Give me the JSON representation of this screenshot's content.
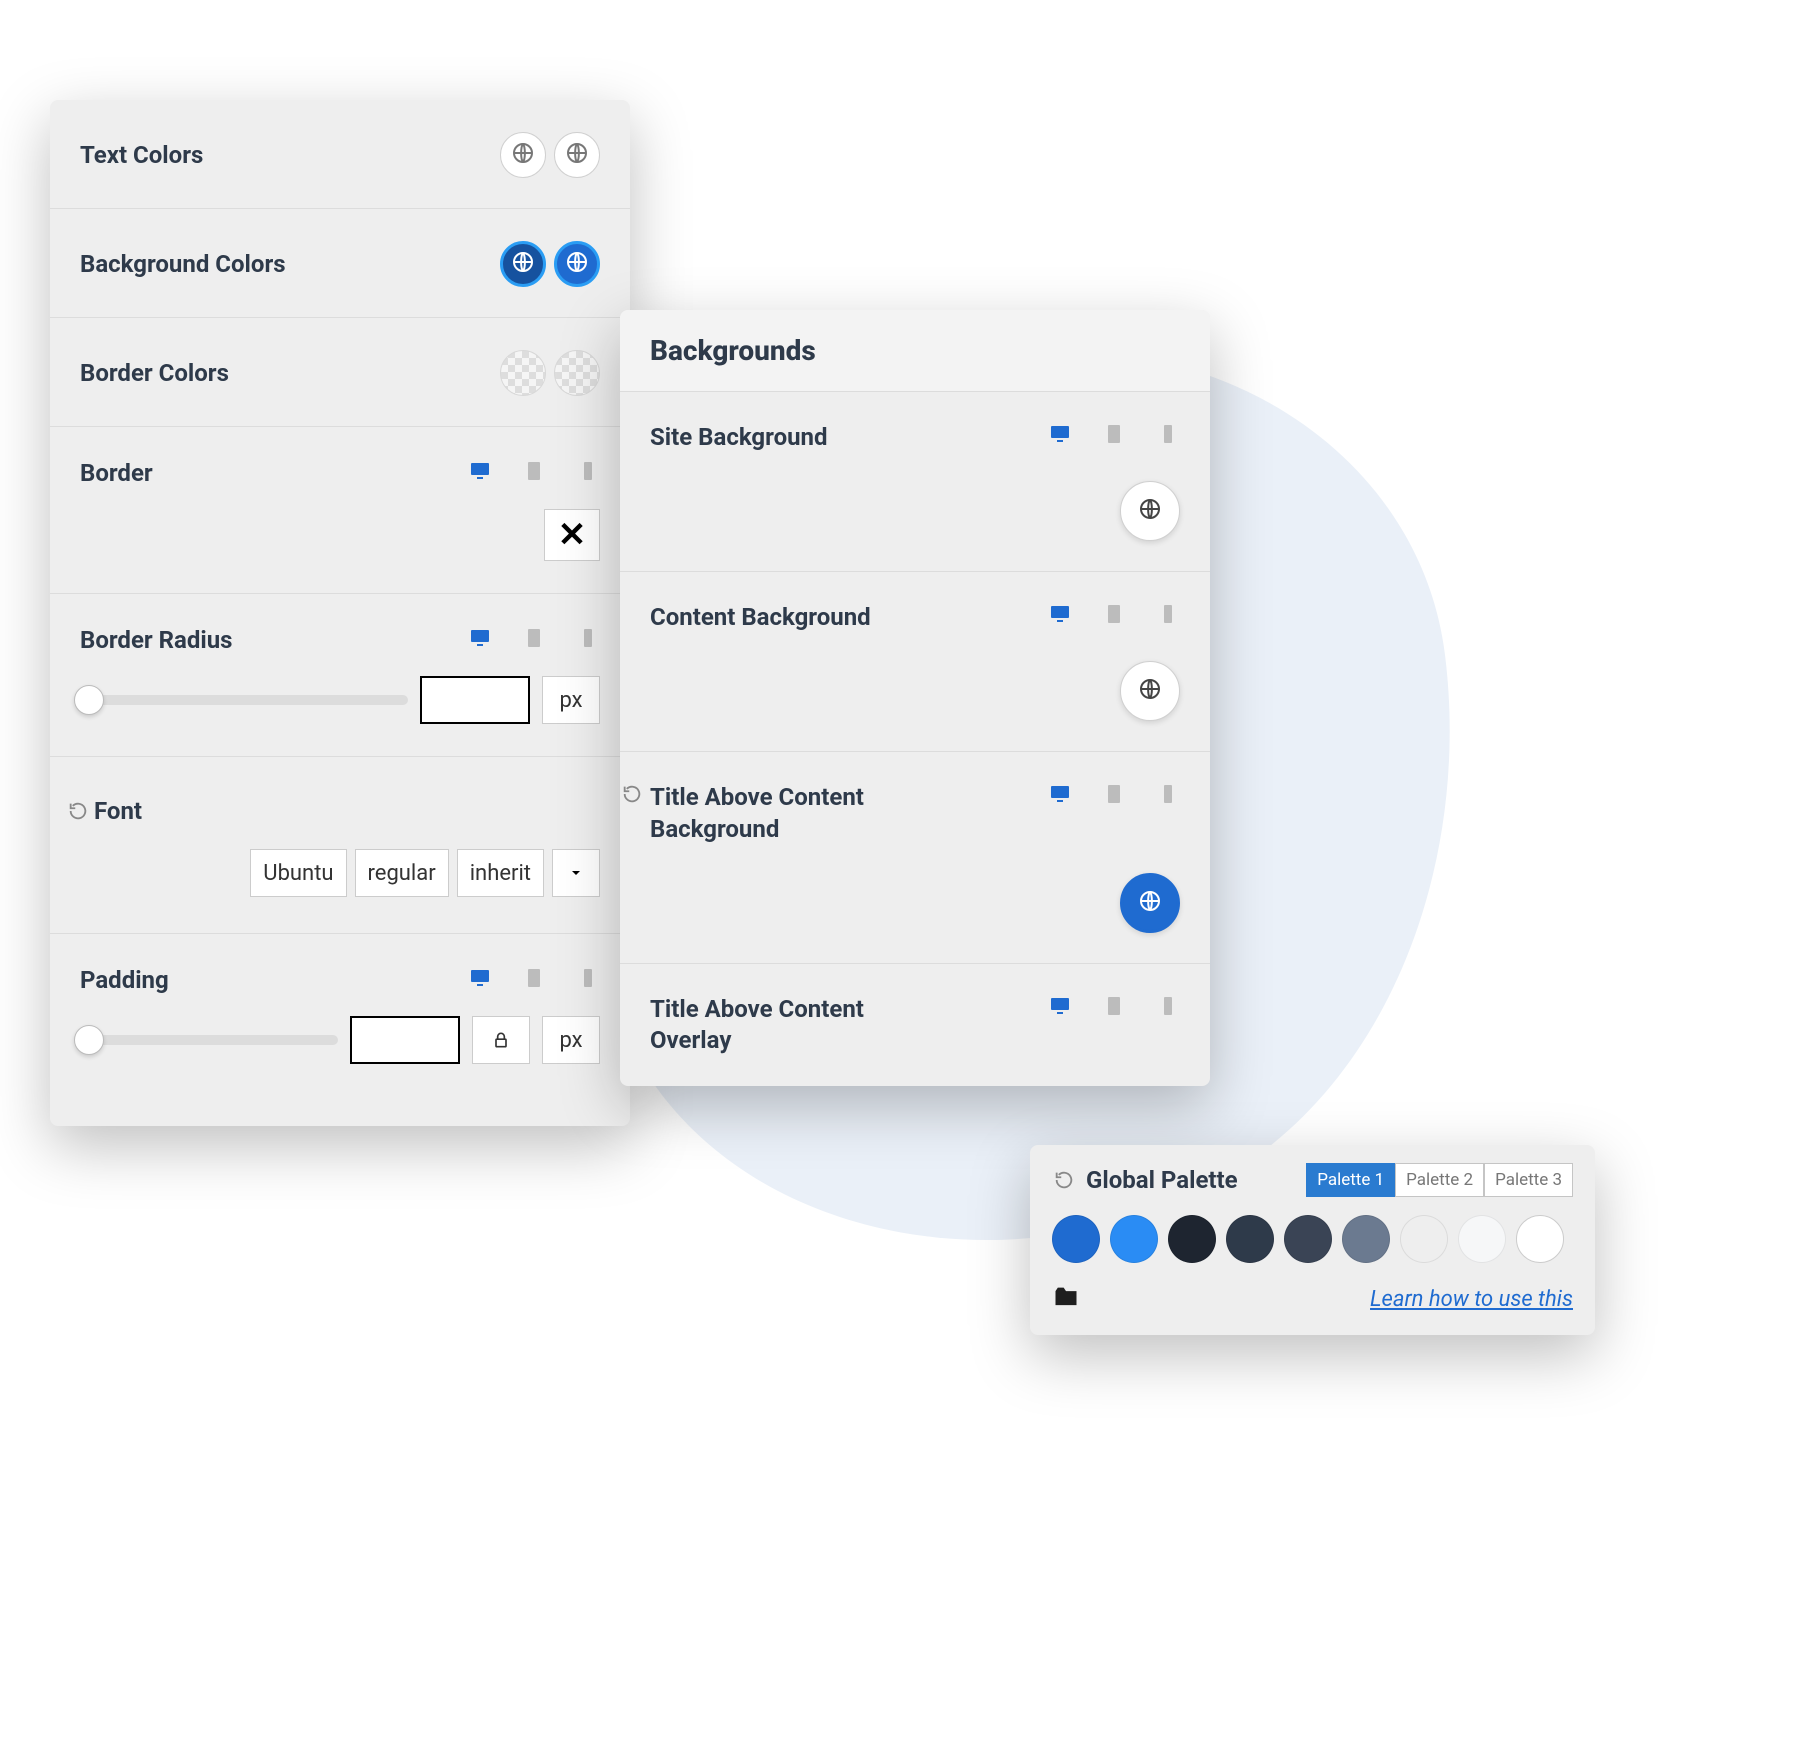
{
  "panel1": {
    "text_colors": {
      "label": "Text Colors"
    },
    "background_colors": {
      "label": "Background Colors"
    },
    "border_colors": {
      "label": "Border Colors"
    },
    "border": {
      "label": "Border"
    },
    "border_radius": {
      "label": "Border Radius",
      "unit": "px",
      "value": ""
    },
    "font": {
      "label": "Font",
      "family": "Ubuntu",
      "weight": "regular",
      "size": "inherit"
    },
    "padding": {
      "label": "Padding",
      "unit": "px",
      "value": ""
    }
  },
  "panel2": {
    "title": "Backgrounds",
    "sections": [
      {
        "label": "Site Background",
        "reset": false,
        "circle": "white"
      },
      {
        "label": "Content Background",
        "reset": false,
        "circle": "white"
      },
      {
        "label": "Title Above Content Background",
        "reset": true,
        "circle": "blue"
      },
      {
        "label": "Title Above Content Overlay ",
        "reset": false,
        "circle": "none"
      }
    ]
  },
  "palette": {
    "title": "Global Palette",
    "tabs": [
      "Palette 1",
      "Palette 2",
      "Palette 3"
    ],
    "active_tab": 0,
    "swatches": [
      "#1f6bd0",
      "#2a8cf4",
      "#1e2530",
      "#2e3a4a",
      "#3a4455",
      "#6b7a90",
      "#eeeeee",
      "#f6f7f8",
      "#ffffff"
    ],
    "learn_link": "Learn how to use this"
  }
}
